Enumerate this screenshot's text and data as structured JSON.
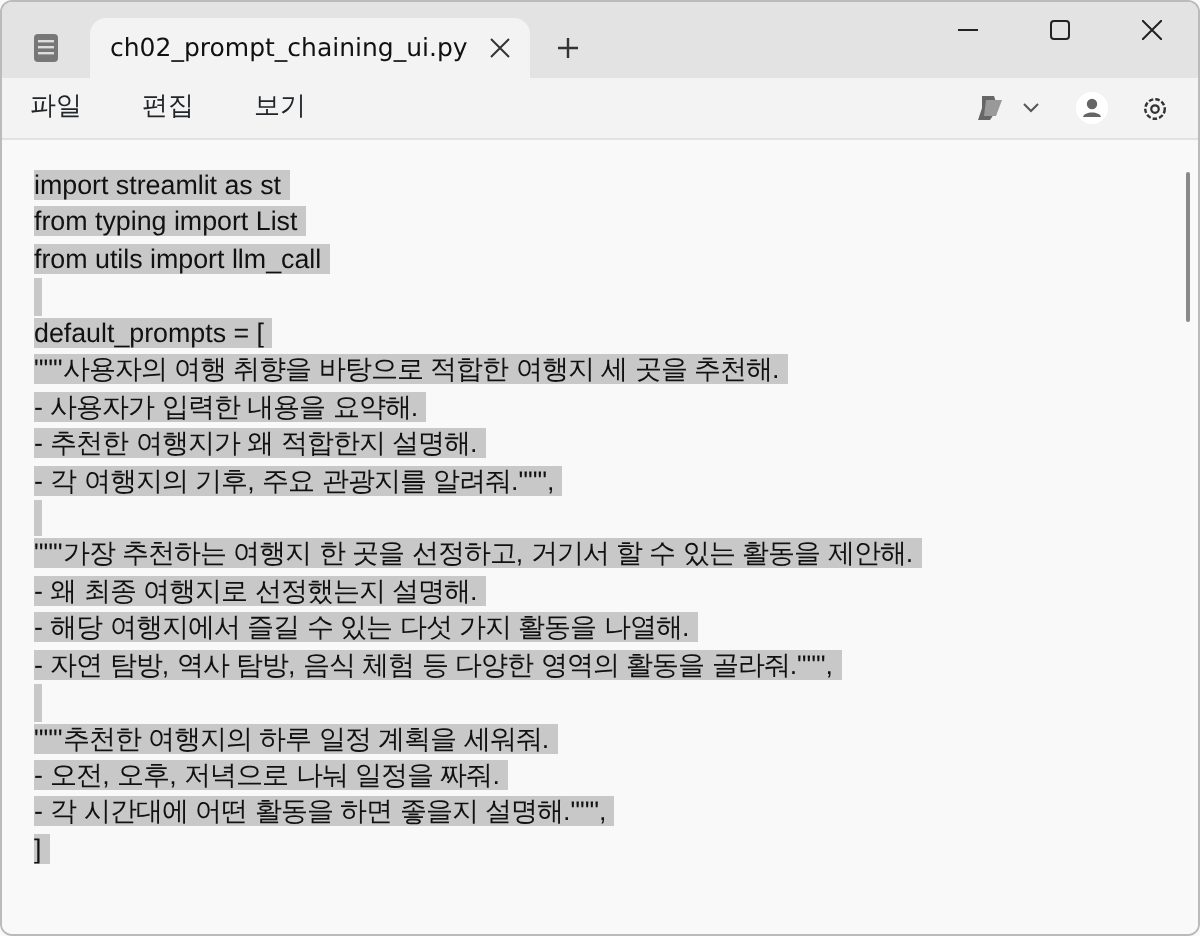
{
  "tabs": [
    {
      "label": "ch02_prompt_chaining_ui.py",
      "selected": true
    }
  ],
  "menu": [
    "파일",
    "편집",
    "보기"
  ],
  "editor": {
    "selected": true,
    "lines": [
      {
        "kind": "text",
        "text": "import streamlit as st"
      },
      {
        "kind": "text",
        "text": "from typing import List"
      },
      {
        "kind": "text",
        "text": "from utils import llm_call"
      },
      {
        "kind": "blank"
      },
      {
        "kind": "text",
        "text": "default_prompts = ["
      },
      {
        "kind": "text",
        "text": "\"\"\"사용자의 여행 취향을 바탕으로 적합한 여행지 세 곳을 추천해."
      },
      {
        "kind": "text",
        "text": "- 사용자가 입력한 내용을 요약해."
      },
      {
        "kind": "text",
        "text": "- 추천한 여행지가 왜 적합한지 설명해."
      },
      {
        "kind": "text",
        "text": "- 각 여행지의 기후, 주요 관광지를 알려줘.\"\"\","
      },
      {
        "kind": "blank"
      },
      {
        "kind": "text",
        "text": "\"\"\"가장 추천하는 여행지 한 곳을 선정하고, 거기서 할 수 있는 활동을 제안해."
      },
      {
        "kind": "text",
        "text": "- 왜 최종 여행지로 선정했는지 설명해."
      },
      {
        "kind": "text",
        "text": "- 해당 여행지에서 즐길 수 있는 다섯 가지 활동을 나열해."
      },
      {
        "kind": "text",
        "text": "- 자연 탐방, 역사 탐방, 음식 체험 등 다양한 영역의 활동을 골라줘.\"\"\","
      },
      {
        "kind": "blank"
      },
      {
        "kind": "text",
        "text": "\"\"\"추천한 여행지의 하루 일정 계획을 세워줘."
      },
      {
        "kind": "text",
        "text": "- 오전, 오후, 저녁으로 나눠 일정을 짜줘."
      },
      {
        "kind": "text",
        "text": "- 각 시간대에 어떤 활동을 하면 좋을지 설명해.\"\"\","
      },
      {
        "kind": "text",
        "text": "]"
      }
    ]
  }
}
